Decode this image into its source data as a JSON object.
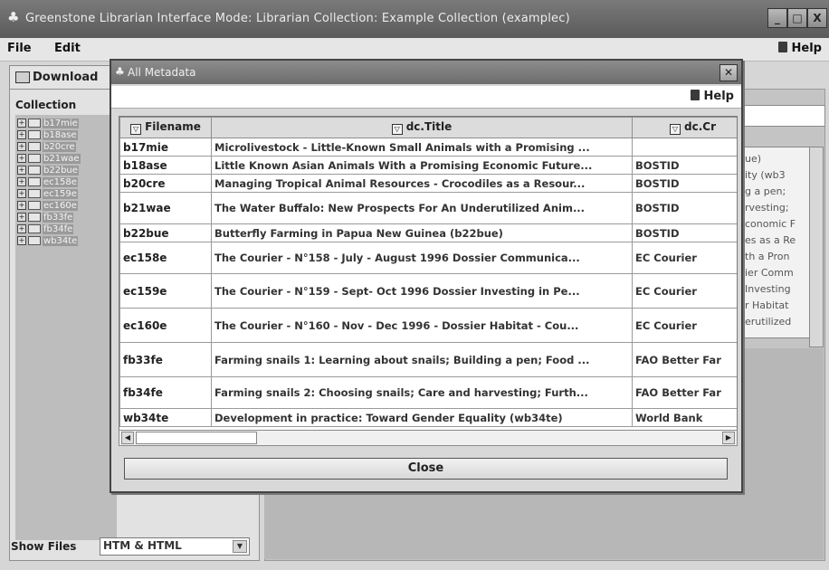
{
  "window": {
    "title": "Greenstone Librarian Interface  Mode: Librarian  Collection: Example Collection (examplec)",
    "controls": {
      "minimize": "_",
      "maximize": "□",
      "close": "X"
    }
  },
  "menubar": {
    "items": [
      "File",
      "Edit"
    ],
    "help": "Help"
  },
  "tabs": {
    "download": "Download"
  },
  "left_panel": {
    "collection_label": "Collection",
    "tree": [
      "b17mie",
      "b18ase",
      "b20cre",
      "b21wae",
      "b22bue",
      "ec158e",
      "ec159e",
      "ec160e",
      "fb33fe",
      "fb34fe",
      "wb34te"
    ],
    "show_files_label": "Show Files",
    "show_files_value": "HTM & HTML"
  },
  "peek_list": [
    "ue)",
    "ity (wb3",
    "g a pen;",
    "rvesting;",
    "conomic F",
    "es as a Re",
    "th a Pron",
    "ier Comm",
    "Investing",
    "r Habitat",
    "erutilized"
  ],
  "dialog": {
    "title": "All Metadata",
    "help": "Help",
    "columns": [
      "Filename",
      "dc.Title",
      "dc.Cr"
    ],
    "rows": [
      {
        "filename": "b17mie",
        "title": "Microlivestock - Little-Known Small Animals with a Promising ...",
        "creator": ""
      },
      {
        "filename": "b18ase",
        "title": "Little Known Asian Animals With a Promising Economic Future...",
        "creator": "BOSTID"
      },
      {
        "filename": "b20cre",
        "title": "Managing Tropical Animal Resources - Crocodiles as a Resour...",
        "creator": "BOSTID"
      },
      {
        "filename": "b21wae",
        "title": "The Water Buffalo: New Prospects For An Underutilized Anim...",
        "creator": "BOSTID"
      },
      {
        "filename": "b22bue",
        "title": "Butterfly Farming in Papua New Guinea (b22bue)",
        "creator": "BOSTID"
      },
      {
        "filename": "ec158e",
        "title": "The Courier - N°158 - July - August 1996 Dossier Communica...",
        "creator": "EC Courier"
      },
      {
        "filename": "ec159e",
        "title": "The Courier - N°159 - Sept- Oct 1996 Dossier Investing in Pe...",
        "creator": "EC Courier"
      },
      {
        "filename": "ec160e",
        "title": "The Courier - N°160 - Nov - Dec 1996 - Dossier Habitat - Cou...",
        "creator": "EC Courier"
      },
      {
        "filename": "fb33fe",
        "title": "Farming snails 1: Learning about snails; Building a pen; Food ...",
        "creator": "FAO Better Far"
      },
      {
        "filename": "fb34fe",
        "title": "Farming snails 2: Choosing snails; Care and harvesting; Furth...",
        "creator": "FAO Better Far"
      },
      {
        "filename": "wb34te",
        "title": "Development in practice: Toward Gender Equality (wb34te)",
        "creator": "World Bank"
      }
    ],
    "close_label": "Close"
  },
  "icons": {
    "app": "tree-icon",
    "help": "book-icon",
    "filter": "funnel-icon",
    "download": "download-icon"
  }
}
